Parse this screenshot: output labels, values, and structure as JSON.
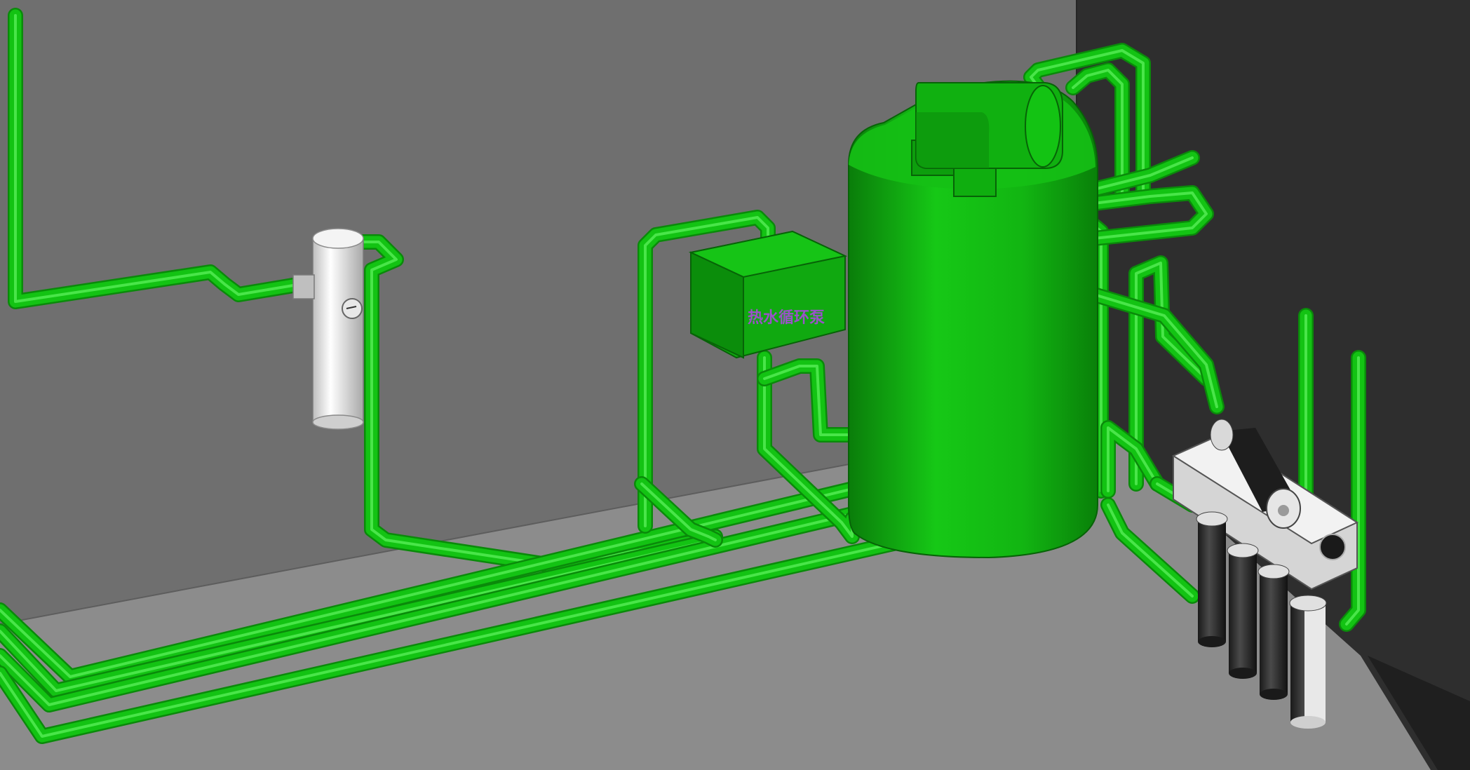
{
  "scene": {
    "pump_box_label": "热水循环泵"
  },
  "colors": {
    "pipe": "#13c313",
    "pipe_shade": "#0a8a0a",
    "tank": "#0fb80f",
    "wall": "#6e6e6e",
    "floor": "#8c8c8c",
    "side_wall": "#2d2d2d"
  },
  "components": {
    "tank_icon": "water-heater-tank",
    "pump_box_icon": "circulation-pump-box",
    "filter_icon": "four-stage-water-filter",
    "softener_icon": "white-cylinder-unit"
  }
}
